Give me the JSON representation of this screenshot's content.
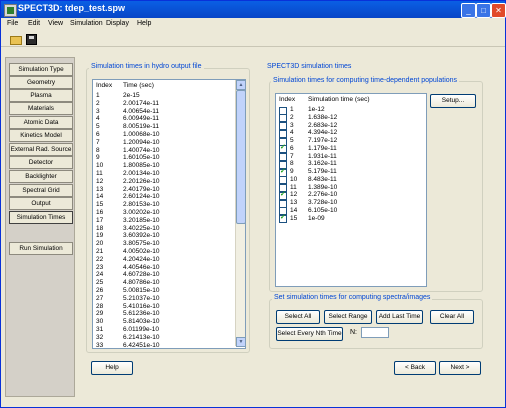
{
  "window": {
    "title": "SPECT3D:  tdep_test.spw"
  },
  "menu": [
    "File",
    "Edit",
    "View",
    "Simulation",
    "Display",
    "Help"
  ],
  "nav": {
    "items": [
      "Simulation Type",
      "Geometry",
      "Plasma",
      "Materials",
      "Atomic Data",
      "Kinetics Model",
      "External Rad. Source",
      "Detector",
      "Backlighter",
      "Spectral Grid",
      "Output",
      "Simulation Times"
    ],
    "active": "Simulation Times",
    "run_label": "Run Simulation"
  },
  "hydro_panel": {
    "title": "Simulation times in hydro output file",
    "col_index": "Index",
    "col_time": "Time (sec)",
    "rows": [
      [
        "1",
        "2e-15"
      ],
      [
        "2",
        "2.00174e-11"
      ],
      [
        "3",
        "4.00654e-11"
      ],
      [
        "4",
        "6.00949e-11"
      ],
      [
        "5",
        "8.00519e-11"
      ],
      [
        "6",
        "1.00068e-10"
      ],
      [
        "7",
        "1.20094e-10"
      ],
      [
        "8",
        "1.40074e-10"
      ],
      [
        "9",
        "1.60105e-10"
      ],
      [
        "10",
        "1.80085e-10"
      ],
      [
        "11",
        "2.00134e-10"
      ],
      [
        "12",
        "2.20126e-10"
      ],
      [
        "13",
        "2.40179e-10"
      ],
      [
        "14",
        "2.60124e-10"
      ],
      [
        "15",
        "2.80153e-10"
      ],
      [
        "16",
        "3.00202e-10"
      ],
      [
        "17",
        "3.20185e-10"
      ],
      [
        "18",
        "3.40225e-10"
      ],
      [
        "19",
        "3.60392e-10"
      ],
      [
        "20",
        "3.80575e-10"
      ],
      [
        "21",
        "4.00502e-10"
      ],
      [
        "22",
        "4.20424e-10"
      ],
      [
        "23",
        "4.40546e-10"
      ],
      [
        "24",
        "4.60728e-10"
      ],
      [
        "25",
        "4.80786e-10"
      ],
      [
        "26",
        "5.00815e-10"
      ],
      [
        "27",
        "5.21037e-10"
      ],
      [
        "28",
        "5.41016e-10"
      ],
      [
        "29",
        "5.61236e-10"
      ],
      [
        "30",
        "5.81403e-10"
      ],
      [
        "31",
        "6.01199e-10"
      ],
      [
        "32",
        "6.21413e-10"
      ],
      [
        "33",
        "6.42451e-10"
      ]
    ]
  },
  "spect_panel": {
    "title": "SPECT3D simulation times",
    "pop_title": "Simulation times for computing time-dependent populations",
    "col_index": "Index",
    "col_time": "Simulation time (sec)",
    "setup_label": "Setup...",
    "rows": [
      {
        "i": "1",
        "t": "1e-12",
        "checked": false
      },
      {
        "i": "2",
        "t": "1.638e-12",
        "checked": false
      },
      {
        "i": "3",
        "t": "2.683e-12",
        "checked": false
      },
      {
        "i": "4",
        "t": "4.394e-12",
        "checked": false
      },
      {
        "i": "5",
        "t": "7.197e-12",
        "checked": false
      },
      {
        "i": "6",
        "t": "1.179e-11",
        "checked": true
      },
      {
        "i": "7",
        "t": "1.931e-11",
        "checked": false
      },
      {
        "i": "8",
        "t": "3.162e-11",
        "checked": false
      },
      {
        "i": "9",
        "t": "5.179e-11",
        "checked": true
      },
      {
        "i": "10",
        "t": "8.483e-11",
        "checked": false
      },
      {
        "i": "11",
        "t": "1.389e-10",
        "checked": false
      },
      {
        "i": "12",
        "t": "2.276e-10",
        "checked": true
      },
      {
        "i": "13",
        "t": "3.728e-10",
        "checked": false
      },
      {
        "i": "14",
        "t": "6.105e-10",
        "checked": false
      },
      {
        "i": "15",
        "t": "1e-09",
        "checked": true
      }
    ],
    "spectra_title": "Set simulation times for computing spectra/images",
    "select_all": "Select All",
    "select_range": "Select Range",
    "add_last_time": "Add Last Time",
    "clear_all": "Clear All",
    "select_nth": "Select Every Nth Time",
    "n_label": "N:",
    "n_value": ""
  },
  "footer": {
    "help": "Help",
    "back": "< Back",
    "next": "Next >"
  }
}
